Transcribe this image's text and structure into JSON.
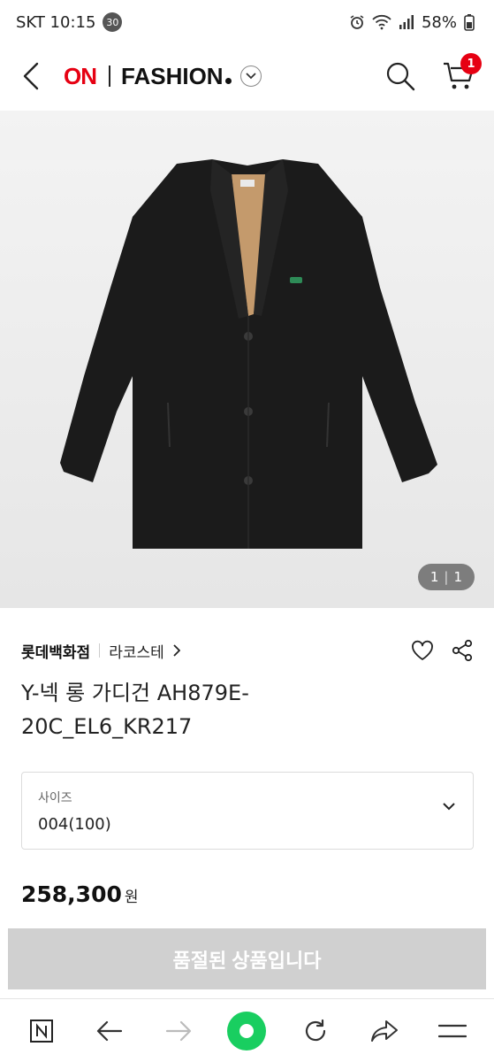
{
  "status_bar": {
    "carrier_time": "SKT 10:15",
    "notification_count": "30",
    "battery": "58%"
  },
  "header": {
    "brand_on": "ON",
    "brand_fashion": "FASHION",
    "cart_count": "1"
  },
  "product": {
    "image_counter_current": "1",
    "image_counter_total": "1",
    "store_name": "롯데백화점",
    "brand_name": "라코스테",
    "title": "Y-넥 롱 가디건 AH879E-20C_EL6_KR217",
    "size_label": "사이즈",
    "size_value": "004(100)",
    "price_value": "258,300",
    "price_unit": "원",
    "soldout_label": "품절된 상품입니다"
  },
  "colors": {
    "accent_red": "#e60012",
    "soldout_gray": "#d0d0d0",
    "naver_green": "#19ce60"
  },
  "browser_bar": {
    "icons": [
      "naver-n-icon",
      "back-arrow-icon",
      "forward-arrow-icon",
      "green-home-icon",
      "reload-icon",
      "share-icon",
      "menu-icon"
    ]
  }
}
